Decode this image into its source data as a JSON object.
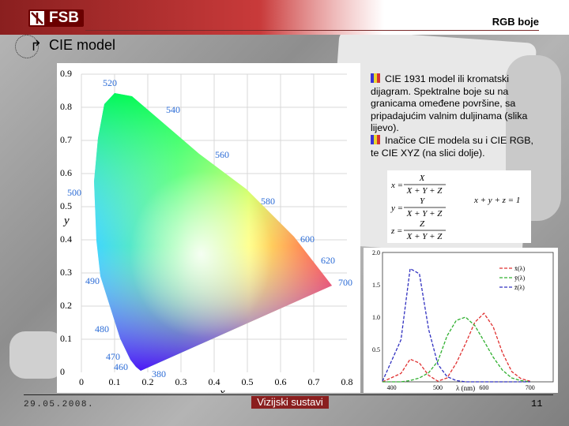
{
  "header": {
    "logo_text": "FSB",
    "right_title": "RGB boje",
    "brand_color": "#8a1f1f"
  },
  "slide": {
    "title": "CIE model",
    "title_icon": "arrow-icon"
  },
  "cie_diagram": {
    "x_axis_label": "x",
    "y_axis_label": "y",
    "x_ticks": [
      "0",
      "0.1",
      "0.2",
      "0.3",
      "0.4",
      "0.5",
      "0.6",
      "0.7",
      "0.8"
    ],
    "y_ticks": [
      "0",
      "0.1",
      "0.2",
      "0.3",
      "0.4",
      "0.5",
      "0.6",
      "0.7",
      "0.8",
      "0.9"
    ],
    "wavelength_labels": [
      "380",
      "460",
      "470",
      "480",
      "490",
      "500",
      "520",
      "540",
      "560",
      "580",
      "600",
      "620",
      "700"
    ]
  },
  "body": {
    "paragraph1": "CIE 1931 model ili kromatski dijagram. Spektralne boje su na granicama omeđene površine, sa pripadajućim valnim duljinama (slika lijevo).",
    "paragraph2": "Inačice CIE modela su i CIE RGB, te CIE XYZ (na slici dolje)."
  },
  "formula": {
    "x_lhs": "x =",
    "y_lhs": "y =",
    "z_lhs": "z =",
    "x_num": "X",
    "y_num": "Y",
    "z_num": "Z",
    "denominator": "X + Y + Z",
    "sum_identity": "x + y + z = 1"
  },
  "cmf_chart": {
    "legend": [
      "x̄(λ)",
      "ȳ(λ)",
      "z̄(λ)"
    ],
    "colors": [
      "#e03030",
      "#30b030",
      "#3030c0"
    ],
    "x_ticks": [
      "400",
      "500",
      "600",
      "700"
    ],
    "y_ticks": [
      "0.5",
      "1.0",
      "1.5",
      "2.0"
    ],
    "x_label": "λ (nm)"
  },
  "footer": {
    "date": "29.05.2008.",
    "center": "Vizijski sustavi",
    "page": "11"
  },
  "chart_data": {
    "type": "line",
    "x": [
      380,
      420,
      440,
      460,
      480,
      500,
      520,
      540,
      560,
      580,
      600,
      620,
      640,
      660,
      680,
      700
    ],
    "series": [
      {
        "name": "x̄(λ)",
        "values": [
          0.0,
          0.13,
          0.35,
          0.29,
          0.1,
          0.01,
          0.06,
          0.29,
          0.59,
          0.92,
          1.06,
          0.85,
          0.45,
          0.16,
          0.05,
          0.01
        ]
      },
      {
        "name": "ȳ(λ)",
        "values": [
          0.0,
          0.0,
          0.02,
          0.06,
          0.14,
          0.32,
          0.71,
          0.95,
          1.0,
          0.87,
          0.63,
          0.38,
          0.18,
          0.06,
          0.02,
          0.0
        ]
      },
      {
        "name": "z̄(λ)",
        "values": [
          0.01,
          0.65,
          1.75,
          1.67,
          0.81,
          0.27,
          0.08,
          0.02,
          0.0,
          0.0,
          0.0,
          0.0,
          0.0,
          0.0,
          0.0,
          0.0
        ]
      }
    ],
    "xlabel": "λ (nm)",
    "ylabel": "",
    "xlim": [
      380,
      750
    ],
    "ylim": [
      0,
      2.0
    ],
    "legend_position": "top-right"
  }
}
